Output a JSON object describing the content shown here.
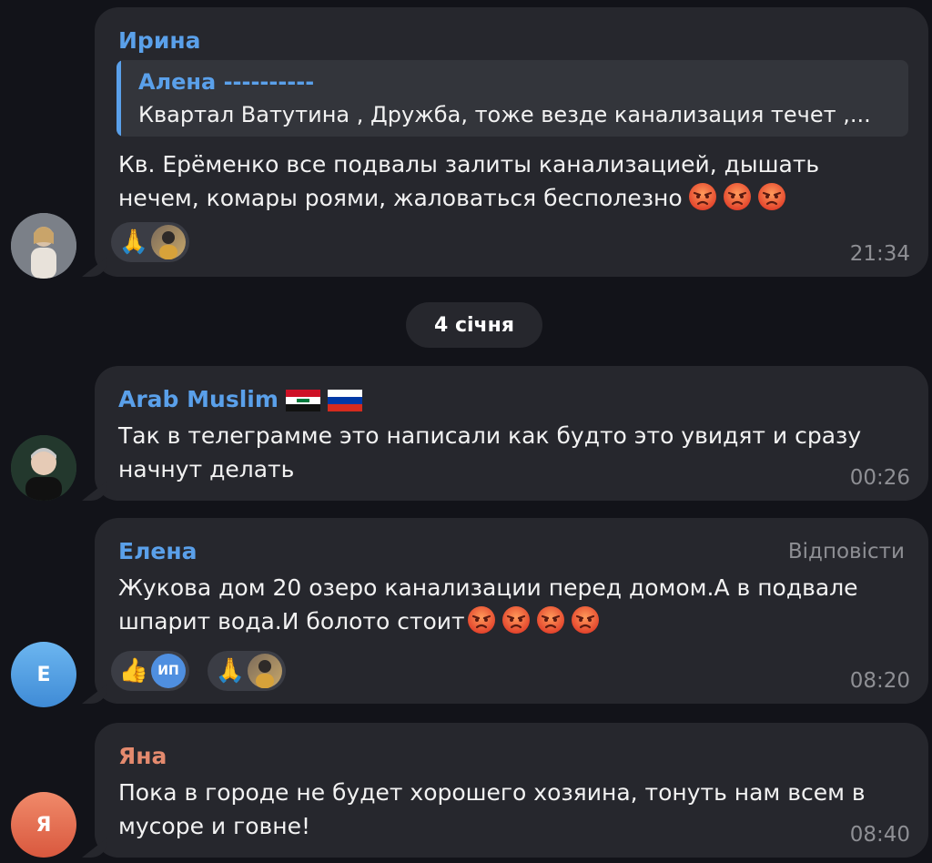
{
  "date_separator": "4 січня",
  "messages": [
    {
      "sender": "Ирина",
      "sender_color": "#5aa0ea",
      "quote": {
        "name": "Алена ----------",
        "text": "Квартал Ватутина , Дружба, тоже везде канализация течет ,..."
      },
      "text": "Кв. Ерёменко все подвалы залиты канализацией, дышать\nнечем, комары роями, жаловаться бесполезно",
      "time": "21:34",
      "reactions": [
        {
          "emoji": "🙏"
        }
      ]
    },
    {
      "sender": "Arab Muslim",
      "sender_color": "#5aa0ea",
      "text": "Так в телеграмме это написали как будто это увидят и сразу\nначнут делать",
      "time": "00:26"
    },
    {
      "sender": "Елена",
      "sender_color": "#5aa0ea",
      "reply_label": "Відповісти",
      "text": "Жукова дом 20 озеро канализации перед домом.А в подвале\nшпарит вода.И болото стоит",
      "time": "08:20",
      "avatar_letter": "Е",
      "reactions": [
        {
          "emoji": "👍",
          "initials": "ИП"
        },
        {
          "emoji": "🙏"
        }
      ]
    },
    {
      "sender": "Яна",
      "sender_color": "#e48a6e",
      "text": "Пока в городе не будет хорошего хозяина, тонуть нам всем в\nмусоре и говне!",
      "time": "08:40",
      "avatar_letter": "Я"
    }
  ],
  "colors": {
    "background": "#121319",
    "bubble": "#26272d",
    "accent": "#5aa0ea",
    "muted": "#8e8f94"
  }
}
